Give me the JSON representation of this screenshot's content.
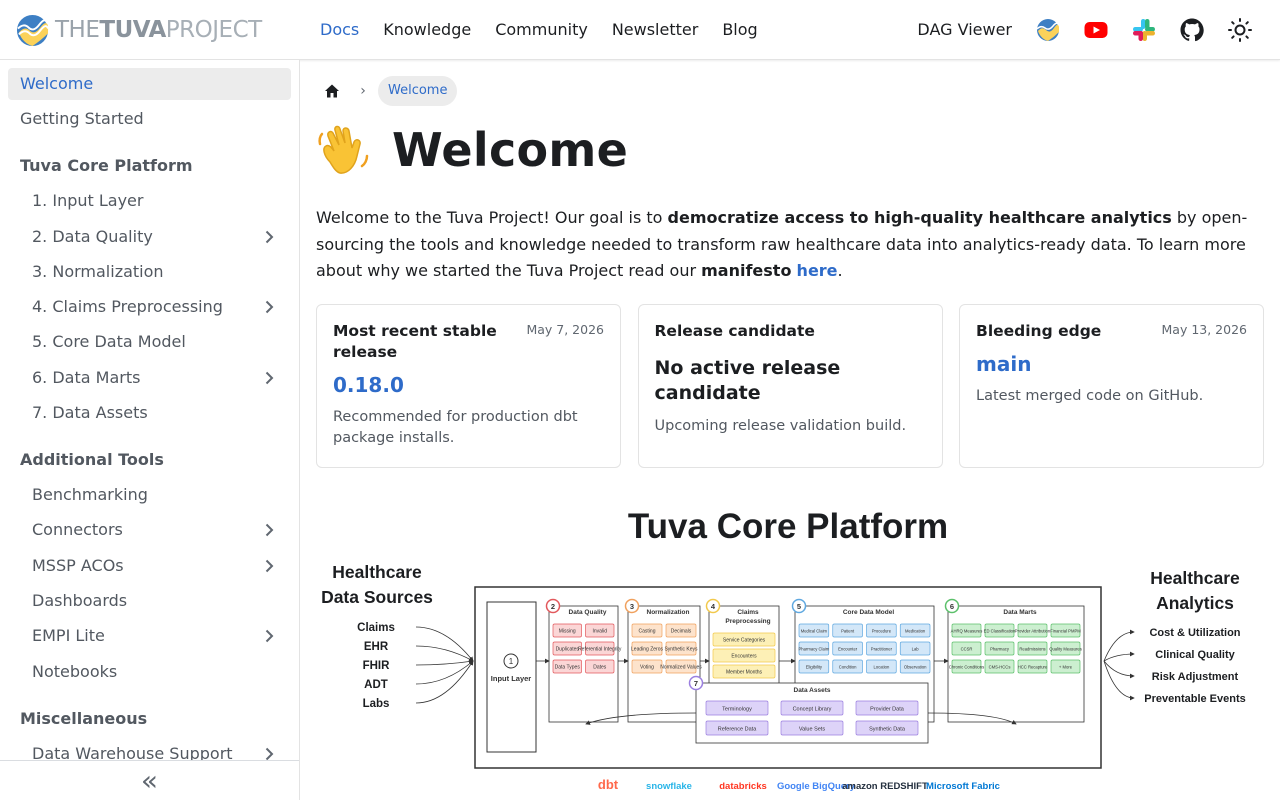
{
  "brand": {
    "part1": "THE",
    "part2": "TUVA",
    "part3": "PROJECT"
  },
  "nav": {
    "links": [
      "Docs",
      "Knowledge",
      "Community",
      "Newsletter",
      "Blog"
    ],
    "dag_viewer": "DAG Viewer"
  },
  "sidebar": {
    "items": [
      {
        "label": "Welcome"
      },
      {
        "label": "Getting Started"
      }
    ],
    "core_platform": {
      "heading": "Tuva Core Platform",
      "items": [
        "1. Input Layer",
        "2. Data Quality",
        "3. Normalization",
        "4. Claims Preprocessing",
        "5. Core Data Model",
        "6. Data Marts",
        "7. Data Assets"
      ]
    },
    "additional_tools": {
      "heading": "Additional Tools",
      "items": [
        "Benchmarking",
        "Connectors",
        "MSSP ACOs",
        "Dashboards",
        "EMPI Lite",
        "Notebooks"
      ]
    },
    "misc": {
      "heading": "Miscellaneous",
      "items": [
        "Data Warehouse Support"
      ]
    },
    "collapse_label": "«"
  },
  "breadcrumb": {
    "current": "Welcome"
  },
  "page": {
    "emoji": "👋",
    "title": "Welcome",
    "intro": {
      "t1": "Welcome to the Tuva Project! Our goal is to ",
      "b1": "democratize access to high-quality healthcare analytics",
      "t2": " by open-sourcing the tools and knowledge needed to transform raw healthcare data into analytics-ready data. To learn more about why we started the Tuva Project read our ",
      "b2": "manifesto",
      "link": "here",
      "t3": "."
    }
  },
  "cards": [
    {
      "title": "Most recent stable release",
      "date": "May 7, 2026",
      "version": "0.18.0",
      "desc": "Recommended for production dbt package installs."
    },
    {
      "title": "Release candidate",
      "big": "No active release candidate",
      "desc": "Upcoming release validation build."
    },
    {
      "title": "Bleeding edge",
      "date": "May 13, 2026",
      "version": "main",
      "desc": "Latest merged code on GitHub."
    }
  ],
  "diagram": {
    "title": "Tuva Core Platform",
    "left_title": [
      "Healthcare",
      "Data Sources"
    ],
    "sources": [
      "Claims",
      "EHR",
      "FHIR",
      "ADT",
      "Labs"
    ],
    "right_title": [
      "Healthcare",
      "Analytics"
    ],
    "outputs": [
      "Cost & Utilization",
      "Clinical Quality",
      "Risk Adjustment",
      "Preventable Events"
    ],
    "input_layer": {
      "num": "1",
      "label": "Input Layer"
    },
    "sections": [
      {
        "num": "2",
        "title": "Data Quality",
        "color": "#e2585c",
        "fill": "#fbd6d6",
        "items": [
          "Missing",
          "Invalid",
          "Duplicates",
          "Referential Integrity",
          "Data Types",
          "Dates"
        ]
      },
      {
        "num": "3",
        "title": "Normalization",
        "color": "#f0a15e",
        "fill": "#fde3cc",
        "items": [
          "Casting",
          "Decimals",
          "Leading Zeros",
          "Synthetic Keys",
          "Voting",
          "Normalized Values"
        ]
      },
      {
        "num": "4",
        "title": "Claims Preprocessing",
        "color": "#f2c94c",
        "fill": "#fdf0b6",
        "items": [
          "Service Categories",
          "Encounters",
          "Member Months"
        ]
      },
      {
        "num": "5",
        "title": "Core Data Model",
        "color": "#5fa8e0",
        "fill": "#d3e7f8",
        "items": [
          "Medical Claim",
          "Patient",
          "Procedure",
          "Medication",
          "Pharmacy Claim",
          "Encounter",
          "Practitioner",
          "Lab",
          "Eligibility",
          "Condition",
          "Location",
          "Observation"
        ]
      },
      {
        "num": "6",
        "title": "Data Marts",
        "color": "#5cc06b",
        "fill": "#ccefd0",
        "items": [
          "AHRQ Measures",
          "ED Classification",
          "Provider Attribution",
          "Financial PMPM",
          "CCSR",
          "Pharmacy",
          "Readmissions",
          "Quality Measures",
          "Chronic Conditions",
          "CMS-HCCs",
          "HCC Recapture",
          "+ More"
        ]
      }
    ],
    "assets": {
      "num": "7",
      "title": "Data Assets",
      "color": "#9b7fe0",
      "fill": "#ddd3f8",
      "items": [
        "Terminology",
        "Concept Library",
        "Provider Data",
        "Reference Data",
        "Value Sets",
        "Synthetic Data"
      ]
    },
    "logos": [
      "dbt",
      "snowflake",
      "databricks",
      "Google BigQuery",
      "amazon REDSHIFT",
      "Microsoft Fabric"
    ]
  }
}
